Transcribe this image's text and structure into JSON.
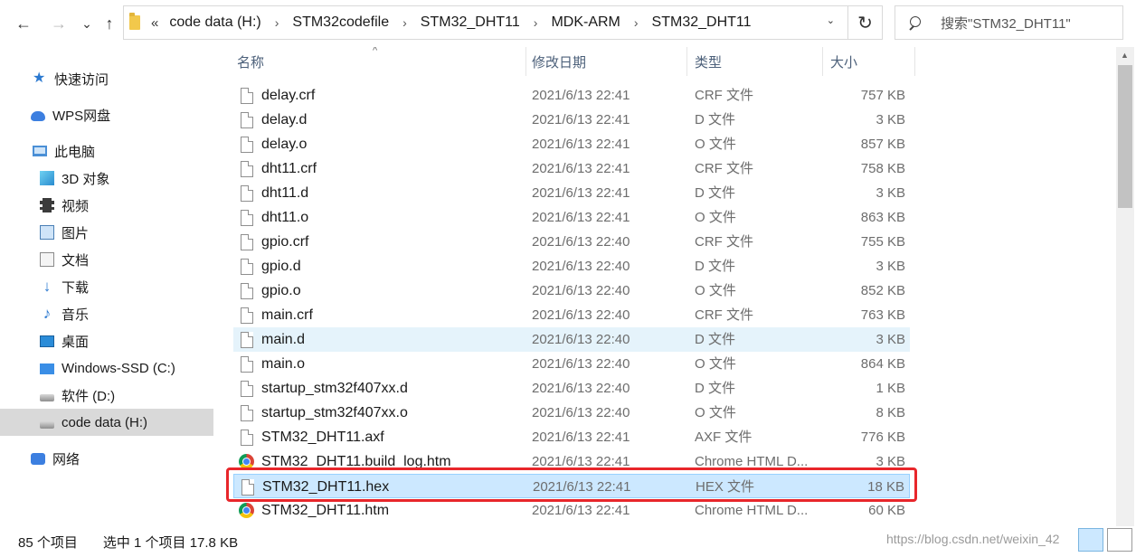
{
  "toolbar": {
    "back": "←",
    "forward": "→",
    "recent": "⌄",
    "up": "↑",
    "overflow": "«",
    "refresh": "↻",
    "dropdown": "⌄"
  },
  "address": {
    "crumbs": [
      "code data (H:)",
      "STM32codefile",
      "STM32_DHT11",
      "MDK-ARM",
      "STM32_DHT11"
    ],
    "separator": "›"
  },
  "search": {
    "placeholder": "搜索\"STM32_DHT11\""
  },
  "sidebar": {
    "items": [
      {
        "label": "快速访问",
        "icon": "star-icon"
      },
      {
        "label": "WPS网盘",
        "icon": "cloud-icon"
      },
      {
        "label": "此电脑",
        "icon": "computer-icon"
      },
      {
        "label": "3D 对象",
        "icon": "cube-icon"
      },
      {
        "label": "视频",
        "icon": "video-icon"
      },
      {
        "label": "图片",
        "icon": "picture-icon"
      },
      {
        "label": "文档",
        "icon": "document-icon"
      },
      {
        "label": "下载",
        "icon": "download-icon"
      },
      {
        "label": "音乐",
        "icon": "music-icon"
      },
      {
        "label": "桌面",
        "icon": "desktop-icon"
      },
      {
        "label": "Windows-SSD (C:)",
        "icon": "drive-icon"
      },
      {
        "label": "软件 (D:)",
        "icon": "drive-icon"
      },
      {
        "label": "code data (H:)",
        "icon": "drive-icon"
      },
      {
        "label": "网络",
        "icon": "network-icon"
      }
    ]
  },
  "columns": {
    "name": "名称",
    "date": "修改日期",
    "type": "类型",
    "size": "大小",
    "sort_indicator": "^"
  },
  "files": [
    {
      "name": "delay.crf",
      "date": "2021/6/13 22:41",
      "type": "CRF 文件",
      "size": "757 KB",
      "icon": "file-icon"
    },
    {
      "name": "delay.d",
      "date": "2021/6/13 22:41",
      "type": "D 文件",
      "size": "3 KB",
      "icon": "file-icon"
    },
    {
      "name": "delay.o",
      "date": "2021/6/13 22:41",
      "type": "O 文件",
      "size": "857 KB",
      "icon": "file-icon"
    },
    {
      "name": "dht11.crf",
      "date": "2021/6/13 22:41",
      "type": "CRF 文件",
      "size": "758 KB",
      "icon": "file-icon"
    },
    {
      "name": "dht11.d",
      "date": "2021/6/13 22:41",
      "type": "D 文件",
      "size": "3 KB",
      "icon": "file-icon"
    },
    {
      "name": "dht11.o",
      "date": "2021/6/13 22:41",
      "type": "O 文件",
      "size": "863 KB",
      "icon": "file-icon"
    },
    {
      "name": "gpio.crf",
      "date": "2021/6/13 22:40",
      "type": "CRF 文件",
      "size": "755 KB",
      "icon": "file-icon"
    },
    {
      "name": "gpio.d",
      "date": "2021/6/13 22:40",
      "type": "D 文件",
      "size": "3 KB",
      "icon": "file-icon"
    },
    {
      "name": "gpio.o",
      "date": "2021/6/13 22:40",
      "type": "O 文件",
      "size": "852 KB",
      "icon": "file-icon"
    },
    {
      "name": "main.crf",
      "date": "2021/6/13 22:40",
      "type": "CRF 文件",
      "size": "763 KB",
      "icon": "file-icon"
    },
    {
      "name": "main.d",
      "date": "2021/6/13 22:40",
      "type": "D 文件",
      "size": "3 KB",
      "icon": "file-icon"
    },
    {
      "name": "main.o",
      "date": "2021/6/13 22:40",
      "type": "O 文件",
      "size": "864 KB",
      "icon": "file-icon"
    },
    {
      "name": "startup_stm32f407xx.d",
      "date": "2021/6/13 22:40",
      "type": "D 文件",
      "size": "1 KB",
      "icon": "file-icon"
    },
    {
      "name": "startup_stm32f407xx.o",
      "date": "2021/6/13 22:40",
      "type": "O 文件",
      "size": "8 KB",
      "icon": "file-icon"
    },
    {
      "name": "STM32_DHT11.axf",
      "date": "2021/6/13 22:41",
      "type": "AXF 文件",
      "size": "776 KB",
      "icon": "file-icon"
    },
    {
      "name": "STM32_DHT11.build_log.htm",
      "date": "2021/6/13 22:41",
      "type": "Chrome HTML D...",
      "size": "3 KB",
      "icon": "chrome-icon"
    },
    {
      "name": "STM32_DHT11.hex",
      "date": "2021/6/13 22:41",
      "type": "HEX 文件",
      "size": "18 KB",
      "icon": "file-icon"
    },
    {
      "name": "STM32_DHT11.htm",
      "date": "2021/6/13 22:41",
      "type": "Chrome HTML D...",
      "size": "60 KB",
      "icon": "chrome-icon"
    }
  ],
  "hovered_file": "main.d",
  "selected_file": "STM32_DHT11.hex",
  "status": {
    "count": "85 个项目",
    "selection": "选中 1 个项目  17.8 KB",
    "watermark": "https://blog.csdn.net/weixin_42"
  },
  "colors": {
    "highlight": "#e8262b",
    "selection": "#cce8ff",
    "hover": "#e5f3fb"
  }
}
